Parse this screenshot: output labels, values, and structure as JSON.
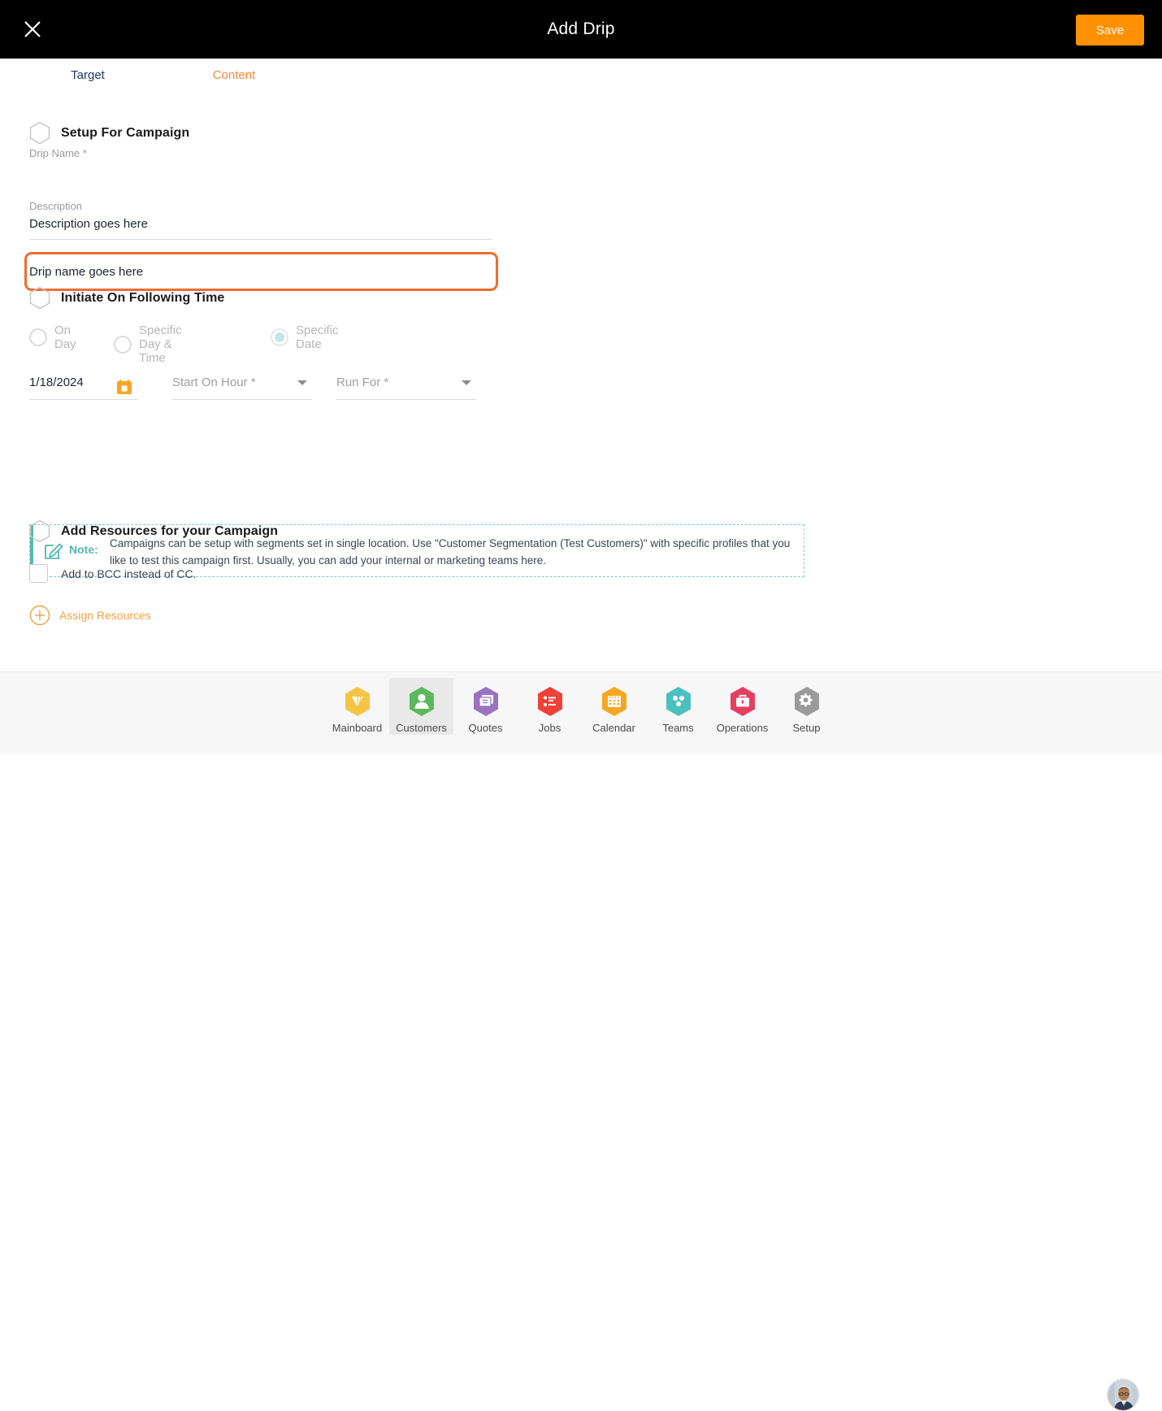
{
  "window": {
    "title": "Add Drip",
    "close_icon": "close-icon",
    "save_label": "Save",
    "accent_orange": "#ff9100",
    "focus_ring_color": "#ef6c2e"
  },
  "tabs": [
    {
      "label": "Target",
      "active": true,
      "color": "#1f3864"
    },
    {
      "label": "Content",
      "active": false,
      "color": "#f5893a"
    }
  ],
  "sections": {
    "setup": {
      "title": "Setup For Campaign",
      "fields": {
        "drip_name": {
          "label": "Drip Name *",
          "value": "Drip name goes here",
          "placeholder": "Drip Name *",
          "focused": true
        },
        "description": {
          "label": "Description",
          "value": "Description goes here",
          "placeholder": "Description"
        }
      }
    },
    "initiate": {
      "title": "Initiate On Following Time",
      "radios": [
        {
          "label": "On Day",
          "selected": false
        },
        {
          "label": "Specific Day & Time",
          "selected": false
        },
        {
          "label": "Specific Date",
          "selected": true
        }
      ],
      "date_value": "1/18/2024",
      "calendar_icon": "calendar-icon",
      "start_on_hour": {
        "placeholder": "Start On Hour *",
        "value": ""
      },
      "run_for": {
        "placeholder": "Run For *",
        "value": ""
      },
      "note": {
        "icon": "note-edit-icon",
        "word": "Note:",
        "text": "Campaigns can be setup with segments set in single location. Use \"Customer Segmentation (Test Customers)\" with specific profiles that you like to test this campaign first. Usually, you can add your internal or marketing teams here.",
        "accent_color": "#52b9b0"
      }
    },
    "resources": {
      "title": "Add Resources for your Campaign",
      "bcc_checkbox": {
        "label": "Add to BCC instead of CC.",
        "checked": false
      },
      "assign": {
        "label": "Assign Resources",
        "icon": "plus-circle-icon",
        "color": "#f0a240"
      }
    }
  },
  "bottom_nav": {
    "items": [
      {
        "label": "Mainboard",
        "icon": "mainboard-icon",
        "color": "#f6c445",
        "active": false
      },
      {
        "label": "Customers",
        "icon": "customers-icon",
        "color": "#5cb85c",
        "active": true
      },
      {
        "label": "Quotes",
        "icon": "quotes-icon",
        "color": "#9a72bf",
        "active": false
      },
      {
        "label": "Jobs",
        "icon": "jobs-icon",
        "color": "#ef4136",
        "active": false
      },
      {
        "label": "Calendar",
        "icon": "calendar-icon",
        "color": "#f5a623",
        "active": false
      },
      {
        "label": "Teams",
        "icon": "teams-icon",
        "color": "#4cbfbf",
        "active": false
      },
      {
        "label": "Operations",
        "icon": "operations-icon",
        "color": "#e63e62",
        "active": false
      },
      {
        "label": "Setup",
        "icon": "setup-icon",
        "color": "#9b9b9b",
        "active": false
      }
    ],
    "avatar": {
      "icon": "user-avatar"
    }
  }
}
